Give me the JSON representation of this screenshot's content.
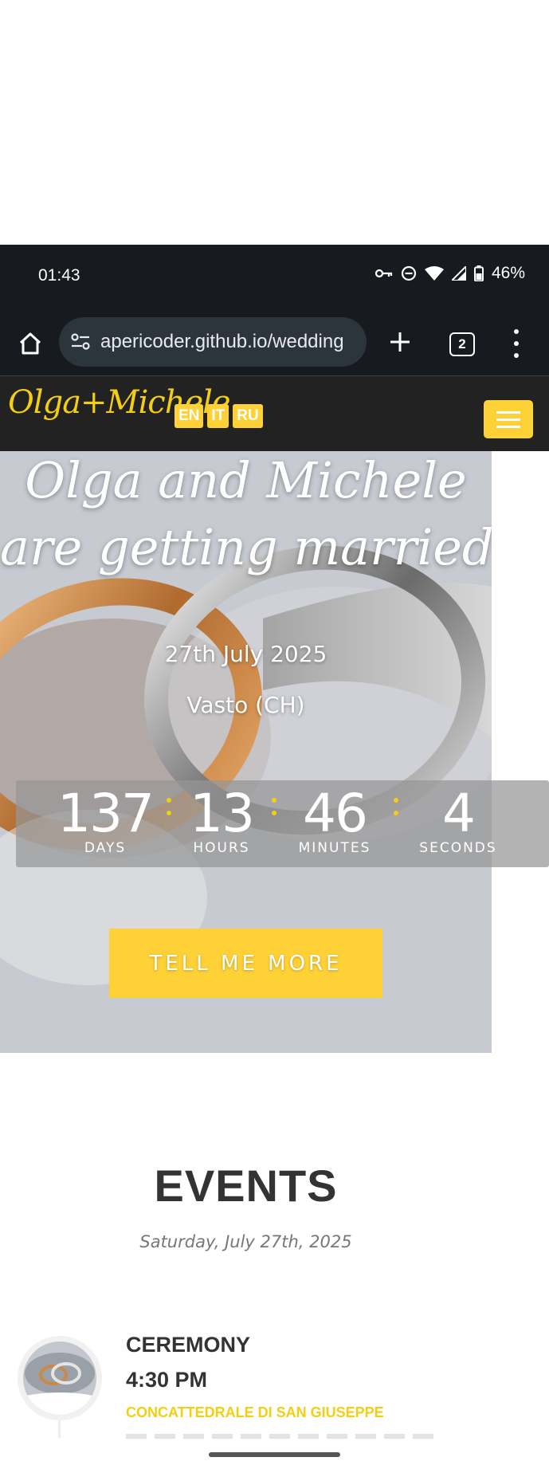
{
  "status_bar": {
    "time": "01:43",
    "battery": "46%"
  },
  "browser": {
    "url": "apericoder.github.io/wedding",
    "tab_count": "2"
  },
  "navbar": {
    "brand": "Olga+Michele",
    "languages": [
      "EN",
      "IT",
      "RU"
    ],
    "accent_color": "#fed136"
  },
  "hero": {
    "title_line1": "Olga and Michele",
    "title_line2": "are getting married",
    "date": "27th July 2025",
    "place": "Vasto (CH)",
    "cta_label": "TELL ME MORE"
  },
  "countdown": {
    "days": "137",
    "days_label": "DAYS",
    "hours": "13",
    "hours_label": "HOURS",
    "minutes": "46",
    "minutes_label": "MINUTES",
    "seconds": "4",
    "seconds_label": "SECONDS"
  },
  "events": {
    "title": "EVENTS",
    "date": "Saturday, July 27th, 2025",
    "items": [
      {
        "name": "CEREMONY",
        "time": "4:30 PM",
        "venue": "CONCATTEDRALE DI SAN GIUSEPPE"
      }
    ]
  }
}
